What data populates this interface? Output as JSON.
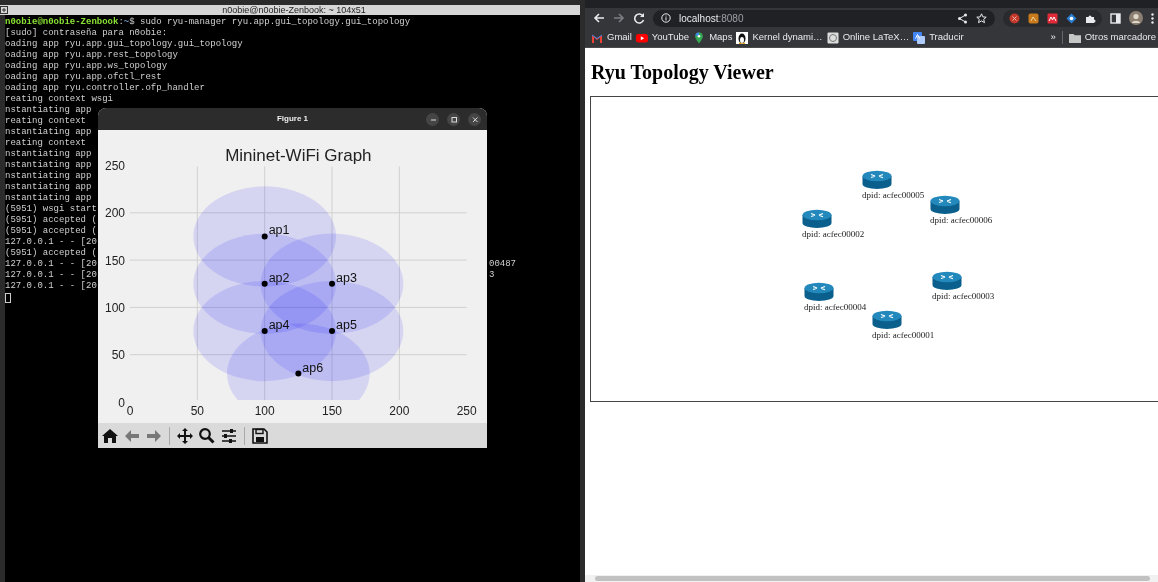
{
  "terminal": {
    "title": "n0obie@n0obie-Zenbook: ~ 104x51",
    "lines": [
      {
        "segments": [
          {
            "kind": "user",
            "text": "n0obie@n0obie-Zenbook"
          },
          {
            "kind": "plain",
            "text": ":"
          },
          {
            "kind": "path",
            "text": "~"
          },
          {
            "kind": "plain",
            "text": "$ sudo ryu-manager ryu.app.gui_topology.gui_topology"
          }
        ]
      },
      {
        "text": "[sudo] contraseña para n0obie:"
      },
      {
        "text": "oading app ryu.app.gui_topology.gui_topology"
      },
      {
        "text": "oading app ryu.app.rest_topology"
      },
      {
        "text": "oading app ryu.app.ws_topology"
      },
      {
        "text": "oading app ryu.app.ofctl_rest"
      },
      {
        "text": "oading app ryu.controller.ofp_handler"
      },
      {
        "text": "reating context wsgi"
      },
      {
        "text": "nstantiating app"
      },
      {
        "text": "reating context"
      },
      {
        "text": "nstantiating app"
      },
      {
        "text": "reating context"
      },
      {
        "text": "nstantiating app"
      },
      {
        "text": "nstantiating app"
      },
      {
        "text": "nstantiating app"
      },
      {
        "text": "nstantiating app"
      },
      {
        "text": "nstantiating app"
      },
      {
        "text": "(5951) wsgi start"
      },
      {
        "text": "(5951) accepted ("
      },
      {
        "text": "(5951) accepted ("
      },
      {
        "text": "127.0.0.1 - - [20"
      },
      {
        "text": "(5951) accepted ("
      },
      {
        "text": "127.0.0.1 - - [20",
        "tail": "00487"
      },
      {
        "text": "127.0.0.1 - - [20",
        "tail": "3"
      },
      {
        "text": "127.0.0.1 - - [20"
      }
    ]
  },
  "figure": {
    "title": "Figure 1",
    "chart_data": {
      "type": "scatter",
      "title": "Mininet-WiFi Graph",
      "x": [
        100,
        100,
        150,
        100,
        150,
        125
      ],
      "series": [
        {
          "color": "#000000",
          "values": [
            175,
            125,
            125,
            75,
            75,
            30
          ]
        }
      ],
      "grid": true,
      "xlim": [
        0,
        250
      ],
      "ylim": [
        0,
        250
      ],
      "xticks": [
        0,
        50,
        100,
        150,
        200,
        250
      ],
      "yticks": [
        0,
        50,
        100,
        150,
        200,
        250
      ],
      "annotations": [
        {
          "x": 100,
          "y": 175,
          "text": "ap1"
        },
        {
          "x": 100,
          "y": 125,
          "text": "ap2"
        },
        {
          "x": 150,
          "y": 125,
          "text": "ap3"
        },
        {
          "x": 100,
          "y": 75,
          "text": "ap4"
        },
        {
          "x": 150,
          "y": 75,
          "text": "ap5"
        },
        {
          "x": 125,
          "y": 30,
          "text": "ap6"
        }
      ]
    }
  },
  "browser": {
    "url": {
      "host": "localhost",
      "port": ":8080"
    },
    "bookmarks": [
      {
        "label": "Gmail"
      },
      {
        "label": "YouTube"
      },
      {
        "label": "Maps"
      },
      {
        "label": "Kernel dynami…"
      },
      {
        "label": "Online LaTeX…"
      },
      {
        "label": "Traducir"
      }
    ],
    "overflow": "»",
    "folder": {
      "label": "Otros marcadore"
    },
    "page": {
      "heading": "Ryu Topology Viewer",
      "nodes": [
        {
          "label": "dpid: acfec00005"
        },
        {
          "label": "dpid: acfec00006"
        },
        {
          "label": "dpid: acfec00002"
        },
        {
          "label": "dpid: acfec00003"
        },
        {
          "label": "dpid: acfec00004"
        },
        {
          "label": "dpid: acfec00001"
        }
      ]
    }
  }
}
